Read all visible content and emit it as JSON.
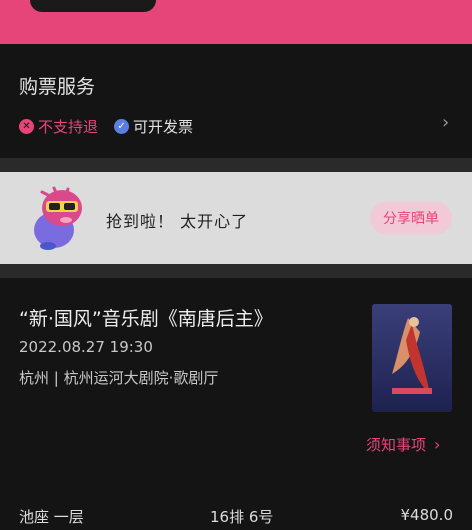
{
  "service": {
    "title": "购票服务",
    "no_refund_label": "不支持退",
    "invoice_label": "可开发票",
    "chevron": "›"
  },
  "share": {
    "text": "抢到啦！ 太开心了",
    "button_label": "分享晒单"
  },
  "show": {
    "title": "“新·国风”音乐剧《南唐后主》",
    "datetime": "2022.08.27 19:30",
    "venue": "杭州 | 杭州运河大剧院·歌剧厅",
    "notice_label": "须知事项",
    "notice_arrow": "›"
  },
  "ticket": {
    "area": "池座 一层",
    "seat": "16排 6号",
    "price": "¥480.0"
  },
  "colors": {
    "accent": "#e6457a",
    "background": "#141414",
    "verified": "#5b7fe0"
  },
  "icons": {
    "no_refund": "x-circle-icon",
    "invoice": "check-circle-icon",
    "chevron": "chevron-right-icon"
  }
}
